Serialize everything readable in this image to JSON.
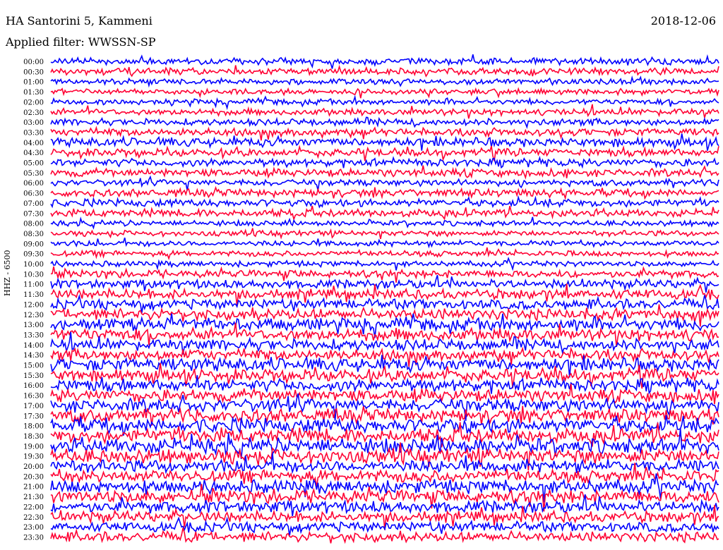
{
  "header": {
    "station": "HA Santorini 5, Kammeni",
    "date": "2018-12-06",
    "filter": "Applied filter: WWSSN-SP"
  },
  "chart_data": {
    "type": "line",
    "title": "HA Santorini 5, Kammeni",
    "ylabel": "HHZ - 6500",
    "xlabel": "",
    "trace_colors": [
      "#0000ff",
      "#ff0033"
    ],
    "rows": [
      {
        "label": "00:00",
        "amp": 0.6
      },
      {
        "label": "00:30",
        "amp": 0.6
      },
      {
        "label": "01:00",
        "amp": 0.5
      },
      {
        "label": "01:30",
        "amp": 0.5
      },
      {
        "label": "02:00",
        "amp": 0.5
      },
      {
        "label": "02:30",
        "amp": 0.6
      },
      {
        "label": "03:00",
        "amp": 0.6
      },
      {
        "label": "03:30",
        "amp": 0.7
      },
      {
        "label": "04:00",
        "amp": 0.8
      },
      {
        "label": "04:30",
        "amp": 0.7
      },
      {
        "label": "05:00",
        "amp": 0.7
      },
      {
        "label": "05:30",
        "amp": 0.7
      },
      {
        "label": "06:00",
        "amp": 0.6
      },
      {
        "label": "06:30",
        "amp": 0.7
      },
      {
        "label": "07:00",
        "amp": 0.7
      },
      {
        "label": "07:30",
        "amp": 0.7
      },
      {
        "label": "08:00",
        "amp": 0.5
      },
      {
        "label": "08:30",
        "amp": 0.5
      },
      {
        "label": "09:00",
        "amp": 0.5
      },
      {
        "label": "09:30",
        "amp": 0.5
      },
      {
        "label": "10:00",
        "amp": 0.5
      },
      {
        "label": "10:30",
        "amp": 0.7
      },
      {
        "label": "11:00",
        "amp": 0.8
      },
      {
        "label": "11:30",
        "amp": 0.9
      },
      {
        "label": "12:00",
        "amp": 0.9
      },
      {
        "label": "12:30",
        "amp": 1.0
      },
      {
        "label": "13:00",
        "amp": 1.1
      },
      {
        "label": "13:30",
        "amp": 1.1
      },
      {
        "label": "14:00",
        "amp": 1.0
      },
      {
        "label": "14:30",
        "amp": 1.0
      },
      {
        "label": "15:00",
        "amp": 1.2
      },
      {
        "label": "15:30",
        "amp": 1.1
      },
      {
        "label": "16:00",
        "amp": 1.1
      },
      {
        "label": "16:30",
        "amp": 1.1
      },
      {
        "label": "17:00",
        "amp": 1.2
      },
      {
        "label": "17:30",
        "amp": 1.2
      },
      {
        "label": "18:00",
        "amp": 1.3
      },
      {
        "label": "18:30",
        "amp": 1.3
      },
      {
        "label": "19:00",
        "amp": 1.4
      },
      {
        "label": "19:30",
        "amp": 1.3
      },
      {
        "label": "20:00",
        "amp": 1.1
      },
      {
        "label": "20:30",
        "amp": 1.1
      },
      {
        "label": "21:00",
        "amp": 1.2
      },
      {
        "label": "21:30",
        "amp": 1.2
      },
      {
        "label": "22:00",
        "amp": 1.1
      },
      {
        "label": "22:30",
        "amp": 1.0
      },
      {
        "label": "23:00",
        "amp": 0.9
      },
      {
        "label": "23:30",
        "amp": 0.9
      }
    ]
  }
}
